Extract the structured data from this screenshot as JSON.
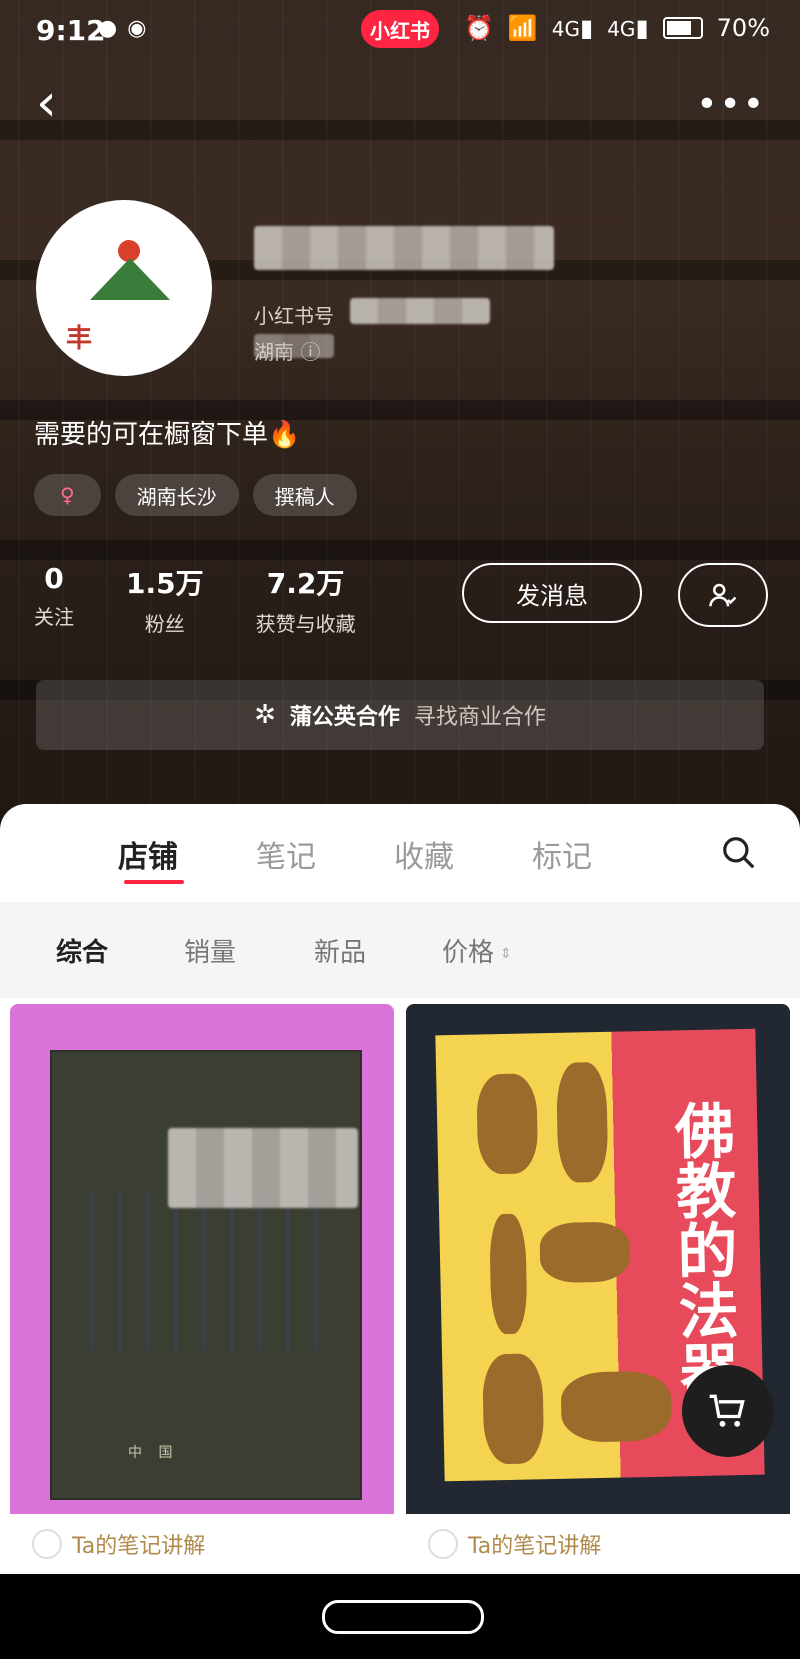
{
  "status_bar": {
    "time": "9:12",
    "app_badge": "小红书",
    "network_1": "4G",
    "network_2": "4G",
    "battery": "70%"
  },
  "profile": {
    "redbook_id_label": "小红书号",
    "location_line": "湖南",
    "bio": "需要的可在橱窗下单🔥",
    "tags": [
      "♀",
      "湖南长沙",
      "撰稿人"
    ],
    "stats": [
      {
        "value": "0",
        "label": "关注"
      },
      {
        "value": "1.5万",
        "label": "粉丝"
      },
      {
        "value": "7.2万",
        "label": "获赞与收藏"
      }
    ],
    "message_button": "发消息"
  },
  "collab": {
    "title": "蒲公英合作",
    "subtitle": "寻找商业合作"
  },
  "tabs": [
    "店铺",
    "笔记",
    "收藏",
    "标记"
  ],
  "filters": [
    "综合",
    "销量",
    "新品",
    "价格"
  ],
  "cards": [
    {
      "footer": "Ta的笔记讲解"
    },
    {
      "footer": "Ta的笔记讲解",
      "book_title": "佛教的法器"
    }
  ],
  "colors": {
    "accent": "#ff2442",
    "footer_text": "#b08a4a"
  }
}
